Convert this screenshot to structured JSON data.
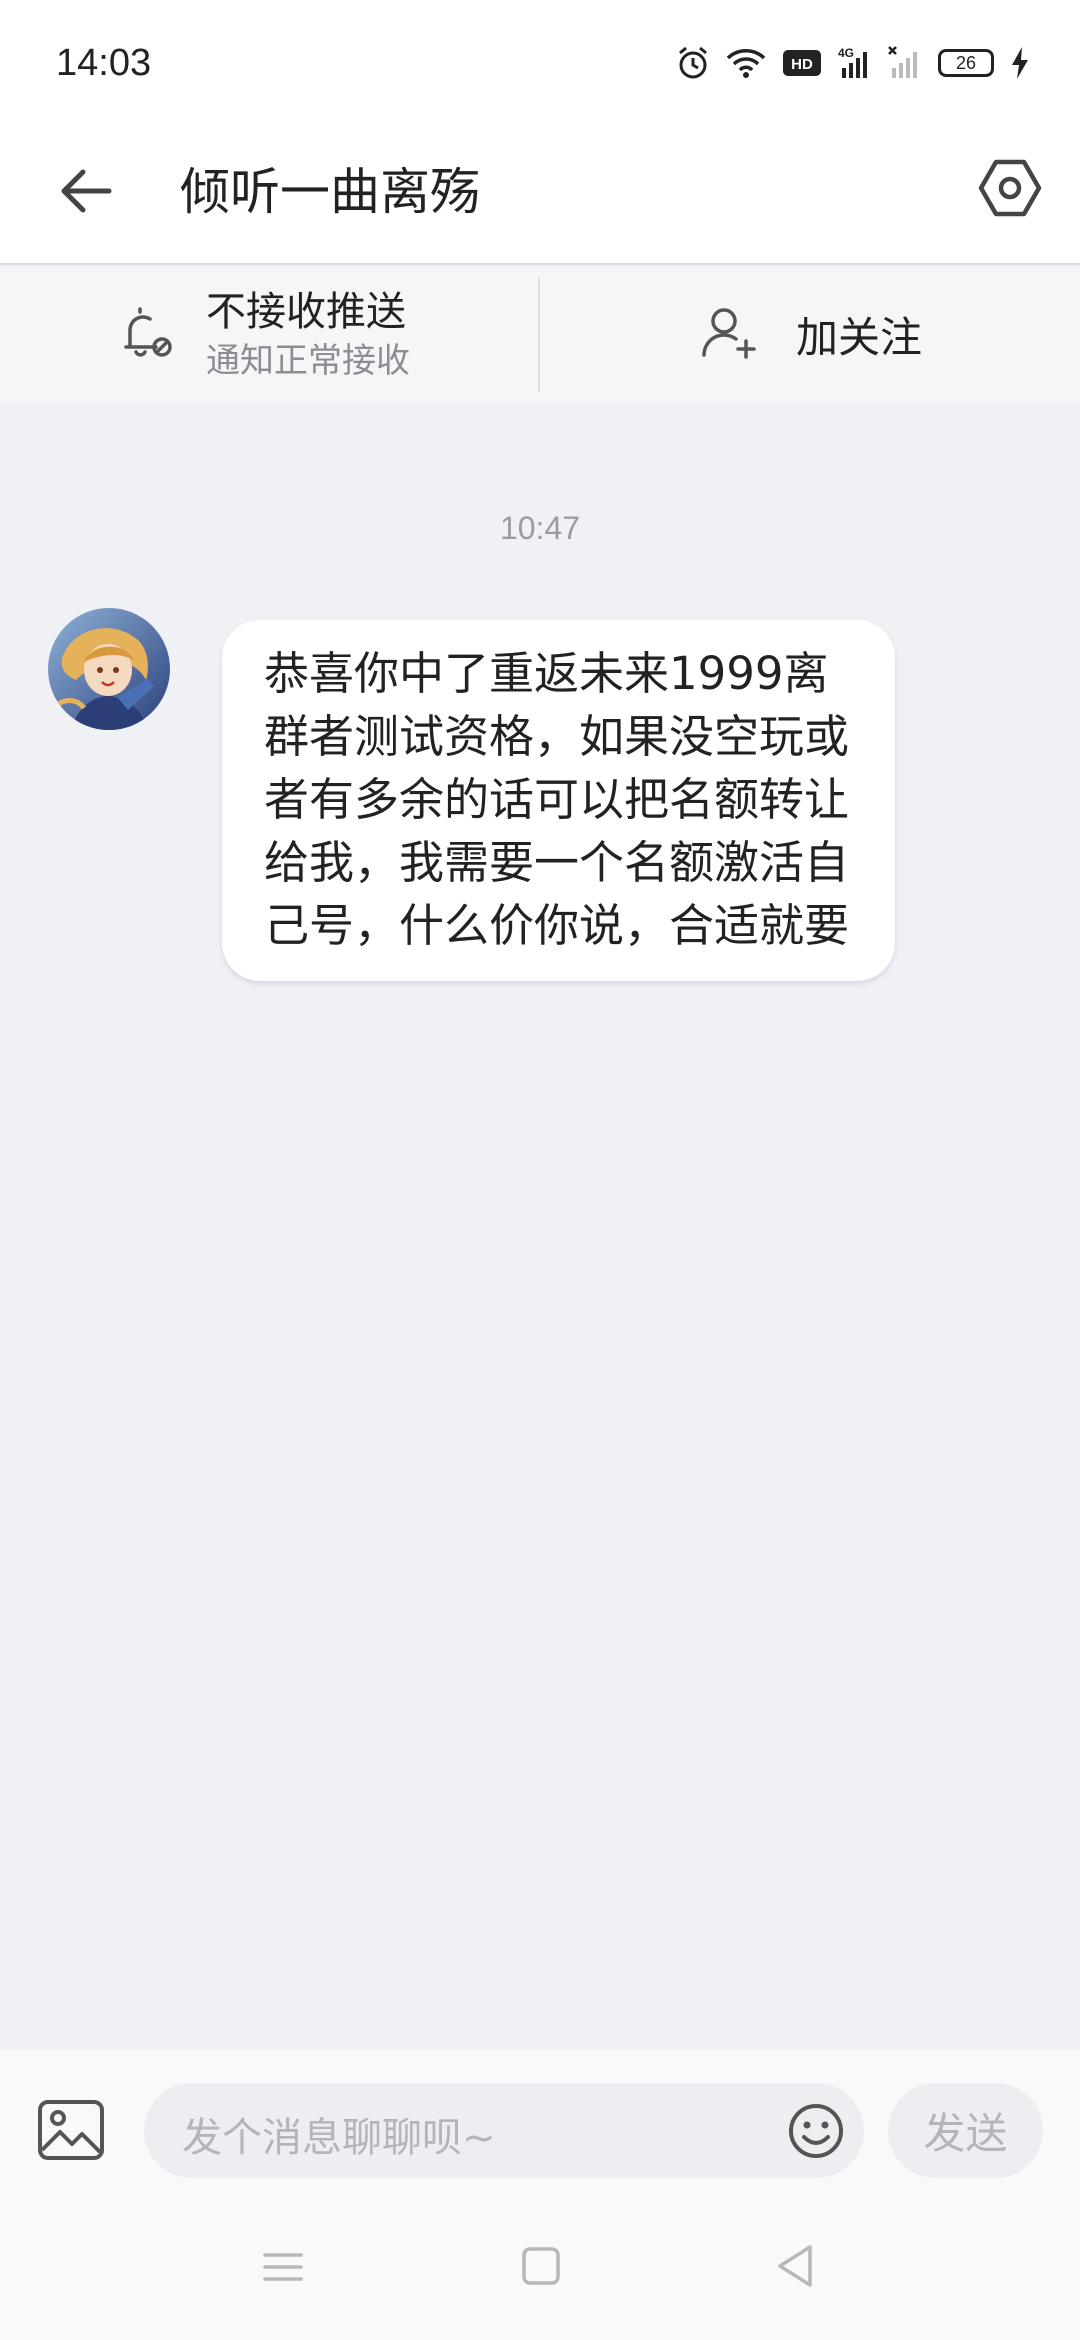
{
  "status_bar": {
    "time": "14:03",
    "battery": "26",
    "icons": [
      "alarm-icon",
      "wifi-icon",
      "hd-icon",
      "signal-4g-icon",
      "signal-no-sim-icon",
      "battery-icon",
      "charging-icon"
    ]
  },
  "header": {
    "title": "倾听一曲离殇",
    "back_icon": "arrow-left-icon",
    "settings_icon": "hexagon-settings-icon"
  },
  "action_bar": {
    "push_title": "不接收推送",
    "push_subtitle": "通知正常接收",
    "follow_label": "加关注"
  },
  "chat": {
    "timestamp": "10:47",
    "messages": [
      {
        "sender": "other",
        "text": "恭喜你中了重返未来1999离群者测试资格，如果没空玩或者有多余的话可以把名额转让给我，我需要一个名额激活自己号，什么价你说，合适就要"
      }
    ]
  },
  "composer": {
    "placeholder": "发个消息聊聊呗~",
    "send_label": "发送"
  },
  "colors": {
    "background": "#eff1f4",
    "bubble": "#ffffff",
    "text_primary": "#222222",
    "text_secondary": "#8a8d93"
  }
}
